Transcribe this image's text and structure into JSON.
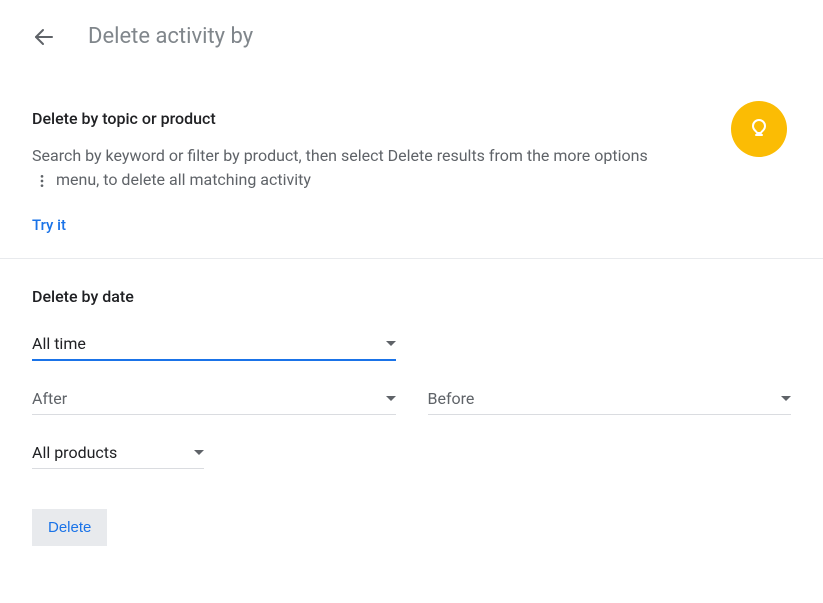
{
  "header": {
    "title": "Delete activity by"
  },
  "topic_section": {
    "heading": "Delete by topic or product",
    "desc_before": "Search by keyword or filter by product, then select Delete results from the more options",
    "desc_after": "menu, to delete all matching activity",
    "try_label": "Try it"
  },
  "date_section": {
    "heading": "Delete by date",
    "range_select": "All time",
    "after_label": "After",
    "before_label": "Before",
    "product_select": "All products",
    "delete_label": "Delete"
  }
}
